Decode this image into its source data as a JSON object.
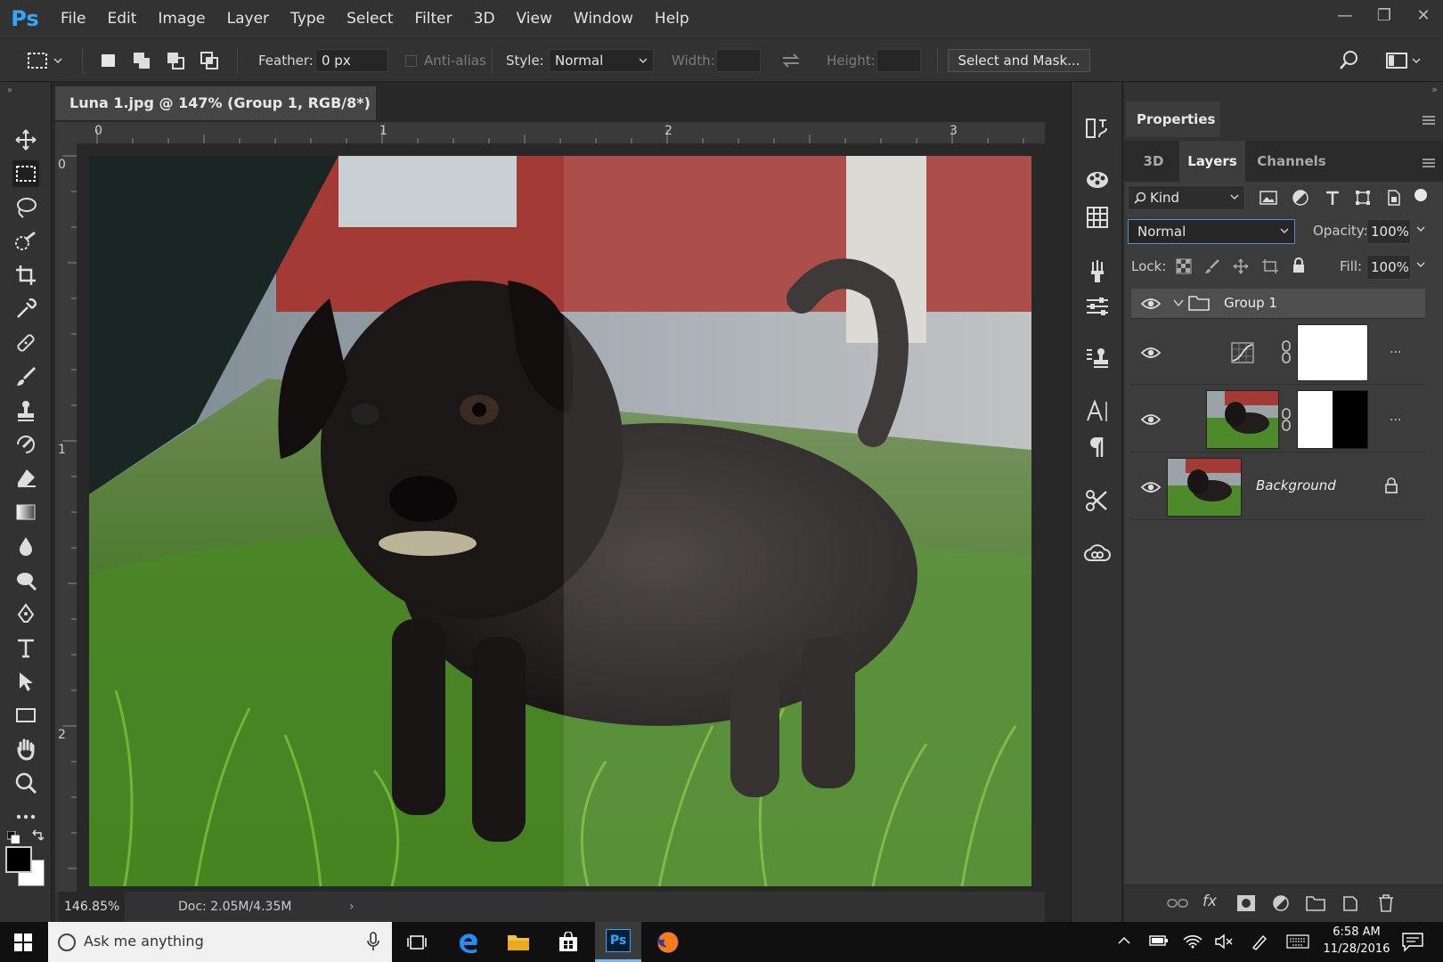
{
  "app": {
    "logo_text": "Ps"
  },
  "menubar": {
    "items": [
      "File",
      "Edit",
      "Image",
      "Layer",
      "Type",
      "Select",
      "Filter",
      "3D",
      "View",
      "Window",
      "Help"
    ]
  },
  "options": {
    "feather_label": "Feather:",
    "feather_value": "0 px",
    "antialias_label": "Anti-alias",
    "style_label": "Style:",
    "style_value": "Normal",
    "width_label": "Width:",
    "height_label": "Height:",
    "select_mask_label": "Select and Mask..."
  },
  "document": {
    "tab_title": "Luna 1.jpg @ 147% (Group 1, RGB/8*) *",
    "ruler_top": [
      "0",
      "1",
      "2",
      "3"
    ],
    "ruler_left": [
      "0",
      "1",
      "2"
    ]
  },
  "status": {
    "zoom": "146.85%",
    "doc": "Doc: 2.05M/4.35M"
  },
  "panels": {
    "properties_label": "Properties",
    "tabs": [
      "3D",
      "Layers",
      "Channels"
    ],
    "filter_kind": "Kind",
    "blend_mode": "Normal",
    "opacity_label": "Opacity:",
    "opacity_value": "100%",
    "lock_label": "Lock:",
    "fill_label": "Fill:",
    "fill_value": "100%"
  },
  "layers": [
    {
      "name": "Group 1"
    },
    {
      "name": ""
    },
    {
      "name": ""
    },
    {
      "name": "Background"
    }
  ],
  "taskbar": {
    "search_placeholder": "Ask me anything",
    "time": "6:58 AM",
    "date": "11/28/2016",
    "ps_label": "Ps"
  }
}
